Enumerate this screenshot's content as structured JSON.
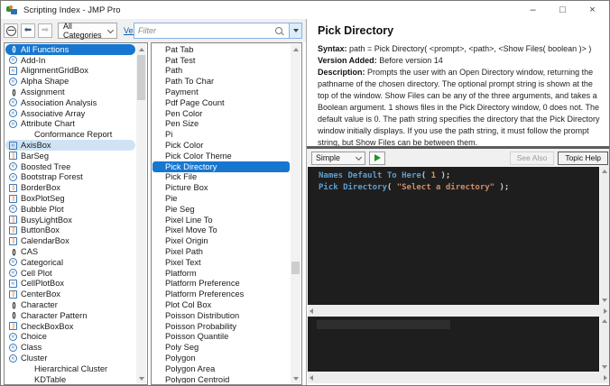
{
  "window": {
    "title": "Scripting Index - JMP Pro",
    "controls": {
      "minimize": "–",
      "maximize": "□",
      "close": "×"
    }
  },
  "colors": {
    "selection_blue": "#1777d0",
    "focus_highlight_blue": "#cfe3f5",
    "link_blue": "#0a5fb4",
    "editor_background": "#1e1e1e",
    "code_function_blue": "#5e9fce",
    "code_number_orange": "#d99a5b",
    "code_string_orange": "#cf8d66",
    "icon_blue": "#3a78b8",
    "icon_orange": "#e0822f"
  },
  "toolbar": {
    "category_dropdown": "All Categories",
    "version_link": "Version",
    "filter_placeholder": "Filter"
  },
  "left_panel": {
    "items": [
      {
        "label": "All Functions",
        "icon": "fn",
        "state": "selected"
      },
      {
        "label": "Add-In",
        "icon": "obj"
      },
      {
        "label": "AlignmentGridBox",
        "icon": "objbox"
      },
      {
        "label": "Alpha Shape",
        "icon": "obj"
      },
      {
        "label": "Assignment",
        "icon": "fn"
      },
      {
        "label": "Association Analysis",
        "icon": "obj"
      },
      {
        "label": "Associative Array",
        "icon": "obj"
      },
      {
        "label": "Attribute Chart",
        "icon": "obj"
      },
      {
        "label": "Conformance Report",
        "icon": "none",
        "indent": true
      },
      {
        "label": "AxisBox",
        "icon": "objbox",
        "state": "focus"
      },
      {
        "label": "BarSeg",
        "icon": "box"
      },
      {
        "label": "Boosted Tree",
        "icon": "obj"
      },
      {
        "label": "Bootstrap Forest",
        "icon": "obj"
      },
      {
        "label": "BorderBox",
        "icon": "box"
      },
      {
        "label": "BoxPlotSeg",
        "icon": "box"
      },
      {
        "label": "Bubble Plot",
        "icon": "obj"
      },
      {
        "label": "BusyLightBox",
        "icon": "box"
      },
      {
        "label": "ButtonBox",
        "icon": "box"
      },
      {
        "label": "CalendarBox",
        "icon": "box"
      },
      {
        "label": "CAS",
        "icon": "fn"
      },
      {
        "label": "Categorical",
        "icon": "obj"
      },
      {
        "label": "Cell Plot",
        "icon": "obj"
      },
      {
        "label": "CellPlotBox",
        "icon": "objbox"
      },
      {
        "label": "CenterBox",
        "icon": "box"
      },
      {
        "label": "Character",
        "icon": "fn"
      },
      {
        "label": "Character Pattern",
        "icon": "fn"
      },
      {
        "label": "CheckBoxBox",
        "icon": "box"
      },
      {
        "label": "Choice",
        "icon": "obj"
      },
      {
        "label": "Class",
        "icon": "obj"
      },
      {
        "label": "Cluster",
        "icon": "obj"
      },
      {
        "label": "Hierarchical Cluster",
        "icon": "none",
        "indent": true
      },
      {
        "label": "KDTable",
        "icon": "none",
        "indent": true
      }
    ]
  },
  "middle_panel": {
    "selected": "Pick Directory",
    "items": [
      "Pat Tab",
      "Pat Test",
      "Path",
      "Path To Char",
      "Payment",
      "Pdf Page Count",
      "Pen Color",
      "Pen Size",
      "Pi",
      "Pick Color",
      "Pick Color Theme",
      "Pick Directory",
      "Pick File",
      "Picture Box",
      "Pie",
      "Pie Seg",
      "Pixel Line To",
      "Pixel Move To",
      "Pixel Origin",
      "Pixel Path",
      "Pixel Text",
      "Platform",
      "Platform Preference",
      "Platform Preferences",
      "Plot Col Box",
      "Poisson Distribution",
      "Poisson Probability",
      "Poisson Quantile",
      "Poly Seg",
      "Polygon",
      "Polygon Area",
      "Polygon Centroid"
    ]
  },
  "detail": {
    "title": "Pick Directory",
    "syntax_label": "Syntax:",
    "syntax_value": "path = Pick Directory( <prompt>, <path>, <Show Files( boolean )> )",
    "version_label": "Version Added:",
    "version_value": "Before version 14",
    "description_label": "Description:",
    "description_value": "Prompts the user with an Open Directory window, returning the pathname of the chosen directory. The optional prompt string is shown at the top of the window. Show Files can be any of the three arguments, and takes a Boolean argument. 1 shows files in the Pick Directory window, 0 does not. The default value is 0. The path string specifies the directory that the Pick Directory window initially displays. If you use the path string, it must follow the prompt string, but Show Files can be between them."
  },
  "example": {
    "mode_dropdown": "Simple",
    "see_also_button": "See Also",
    "topic_help_button": "Topic Help",
    "code_lines": [
      [
        {
          "text": "Names Default To Here",
          "type": "fn"
        },
        {
          "text": "( ",
          "type": "punct"
        },
        {
          "text": "1",
          "type": "num"
        },
        {
          "text": " );",
          "type": "punct"
        }
      ],
      [
        {
          "text": "Pick Directory",
          "type": "fn"
        },
        {
          "text": "( ",
          "type": "punct"
        },
        {
          "text": "\"Select a directory\"",
          "type": "str"
        },
        {
          "text": " );",
          "type": "punct"
        }
      ]
    ]
  }
}
